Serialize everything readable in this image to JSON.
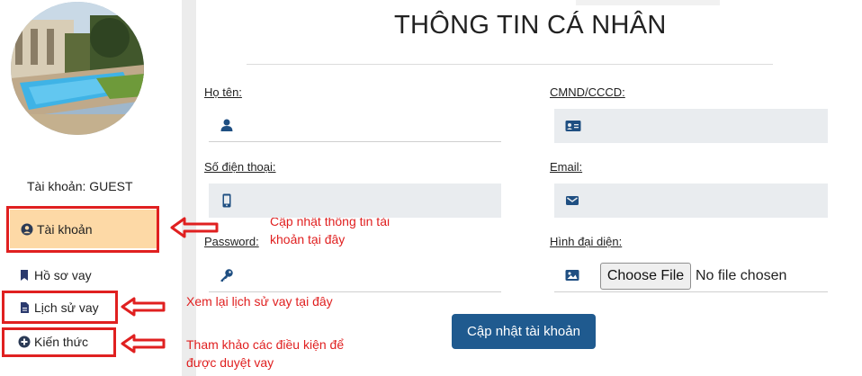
{
  "sidebar": {
    "account_line": "Tài khoản: GUEST",
    "items": [
      {
        "label": "Tài khoản",
        "icon": "user-circle-icon",
        "active": true
      },
      {
        "label": "Hồ sơ vay",
        "icon": "bookmark-icon",
        "active": false
      },
      {
        "label": "Lịch sử vay",
        "icon": "file-icon",
        "active": false
      },
      {
        "label": "Kiến thức",
        "icon": "plus-circle-icon",
        "active": false
      }
    ]
  },
  "annotations": {
    "account": "Cập nhật thông tin tài khoản tại đây",
    "history": "Xem lại lịch sử vay tại đây",
    "knowledge": "Tham khảo các điều kiện để được duyệt vay"
  },
  "form": {
    "title": "THÔNG TIN CÁ NHÂN",
    "fields": {
      "fullname": {
        "label": "Họ tên:",
        "value": "",
        "icon": "user-icon"
      },
      "id_number": {
        "label": "CMND/CCCD:",
        "value": "",
        "icon": "id-card-icon"
      },
      "phone": {
        "label": "Số điện thoại:",
        "value": "",
        "icon": "mobile-phone-icon"
      },
      "email": {
        "label": "Email:",
        "value": "",
        "icon": "envelope-icon"
      },
      "password": {
        "label": "Password:",
        "value": "",
        "icon": "key-icon"
      },
      "avatar": {
        "label": "Hình đại diện:",
        "button": "Choose File",
        "status": "No file chosen",
        "icon": "image-icon"
      }
    },
    "submit_label": "Cập nhật tài khoản"
  },
  "colors": {
    "accent": "#1f5a8f",
    "active_item": "#fdd9a6",
    "annotation_red": "#e02020",
    "input_grey": "#e9ecef"
  }
}
